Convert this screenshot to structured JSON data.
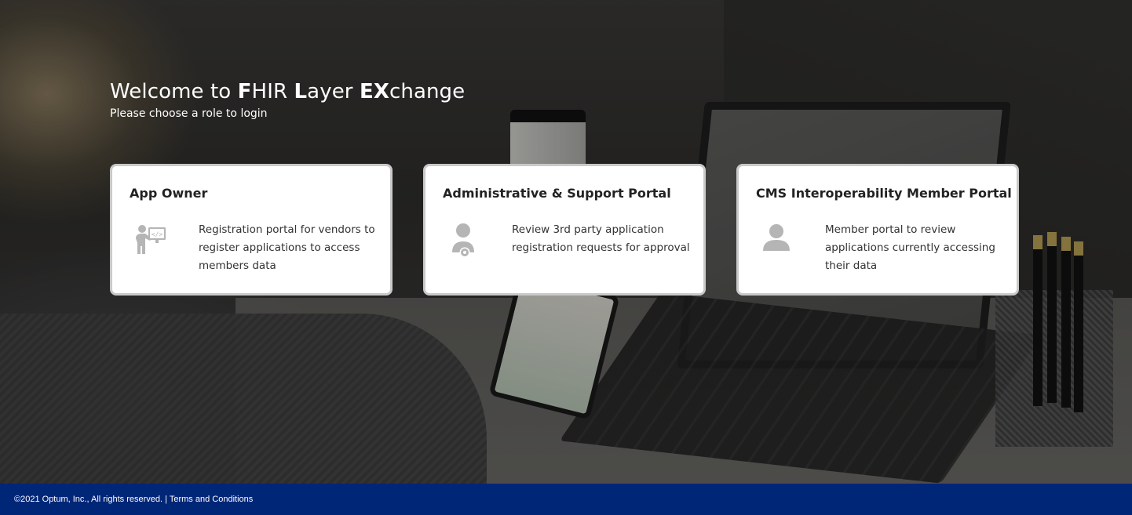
{
  "hero": {
    "title_parts": [
      {
        "text": "Welcome to ",
        "bold": false
      },
      {
        "text": "F",
        "bold": true
      },
      {
        "text": "HIR ",
        "bold": false
      },
      {
        "text": "L",
        "bold": true
      },
      {
        "text": "ayer ",
        "bold": false
      },
      {
        "text": "EX",
        "bold": true
      },
      {
        "text": "change",
        "bold": false
      }
    ],
    "subtitle": "Please choose a role to login"
  },
  "roles": [
    {
      "title": "App Owner",
      "description": "Registration portal for vendors to register applications to access members data",
      "icon": "developer-presenting-icon"
    },
    {
      "title": "Administrative & Support Portal",
      "description": "Review 3rd party application registration requests for approval",
      "icon": "admin-user-gear-icon"
    },
    {
      "title": "CMS Interoperability Member Portal",
      "description": "Member portal to review applications currently accessing their data",
      "icon": "member-user-icon"
    }
  ],
  "footer": {
    "copyright": "©2021 Optum, Inc., All rights reserved. | ",
    "terms_link": "Terms and Conditions"
  },
  "colors": {
    "footer_bg": "#002677",
    "icon_gray": "#b5b5b5",
    "card_border": "#c9c9c9"
  }
}
